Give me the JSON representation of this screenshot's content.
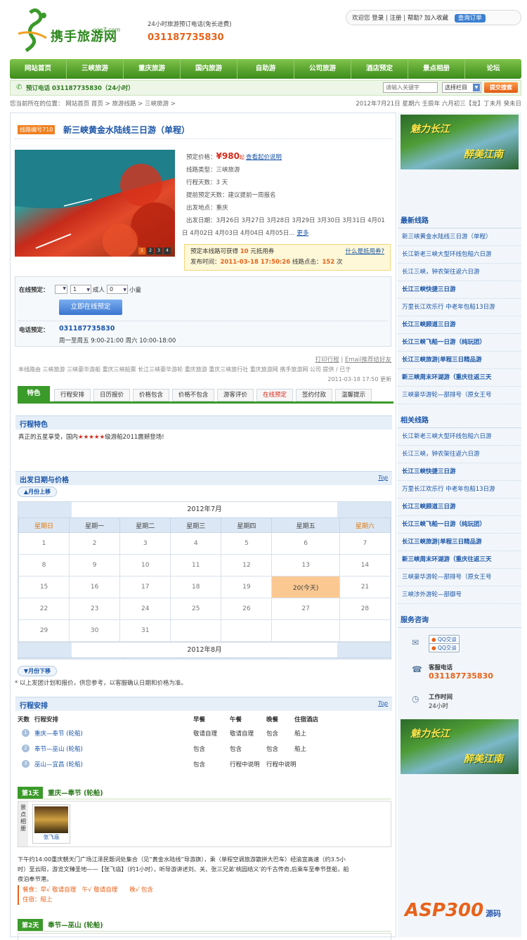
{
  "header": {
    "logo_text": "携手旅游网",
    "logo_domain": "cqe7.com",
    "hotline_label": "24小时旅游预订电话(免长途费)",
    "hotline_number": "031187735830",
    "welcome": "欢迎您",
    "login": "登录",
    "register": "注册",
    "help": "帮助?",
    "bookmark": "加入收藏",
    "order_query": "查询订单"
  },
  "nav": [
    "网站首页",
    "三峡旅游",
    "重庆旅游",
    "国内旅游",
    "自助游",
    "公司旅游",
    "酒店预定",
    "景点相册",
    "论坛"
  ],
  "subbar": {
    "phone": "预订电话 031187735830（24小时）",
    "search_placeholder": "请输入关键字",
    "column_select": "选择栏目",
    "search_button": "提交搜索"
  },
  "breadcrumb": {
    "prefix": "您当前所在的位置：",
    "items": [
      "网站首页 首页",
      "旅游线路",
      "三峡旅游"
    ],
    "date": "2012年7月21日 星期六 壬辰年 六月初三【龙】丁未月 癸未日"
  },
  "route": {
    "code_badge": "线路编号710",
    "title": "新三峡黄金水陆线三日游（单程）",
    "price_label": "预定价格：",
    "price": "¥980",
    "price_suffix": "起",
    "price_link": "查看起价说明",
    "type_label": "线路类型：",
    "type": "三峡旅游",
    "days_label": "行程天数：",
    "days": "3 天",
    "advance_label": "提前预定天数：",
    "advance": "建议提前一周报名",
    "depart_label": "出发地点：",
    "depart": "重庆",
    "dates_label": "出发日期：",
    "dates_line1": "3月26日 3月27日 3月28日 3月29日 3月30日 3月31日 4月01",
    "dates_line2": "日 4月02日 4月03日 4月04日 4月05日...",
    "more": "更多",
    "photo_pages": [
      "1",
      "2",
      "3",
      "4"
    ],
    "coupon_text_a": "预定本线路可获得",
    "coupon_amount": "10",
    "coupon_text_b": "元抵用券",
    "coupon_link": "什么是抵用券?",
    "publish_label": "发布时间：",
    "publish_time": "2011-03-18 17:50:26",
    "clicks_label": "线路点击：",
    "clicks": "152",
    "clicks_unit": "次"
  },
  "booking": {
    "online_label": "在线预定：",
    "adults_value": "1",
    "adults_label": "成人",
    "children_value": "0",
    "children_label": "小童",
    "book_button": "立即在线预定",
    "phone_label": "电话预定：",
    "phone": "031187735830",
    "hours": "周一至周五 9:00-21:00 周六 10:00-18:00"
  },
  "tools": {
    "print": "打印行程",
    "email": "Email推荐给好友"
  },
  "tags_line1": "本线路由 三峡旅游 三峡豪华游船 重庆三峡船票 长江三峡豪华游轮 重庆旅游 重庆三峡旅行社 重庆旅游网 携手旅游网 公司 提供 / 已于",
  "tags_line2": "2011-03-18 17:50 更新",
  "tabs": [
    "特色",
    "行程安排",
    "日历报价",
    "价格包含",
    "价格不包含",
    "游客评价",
    "在线预定",
    "签约付款",
    "温馨提示"
  ],
  "feature": {
    "heading": "行程特色",
    "text_a": "真正的五星享受，国内",
    "stars": "★★★★★",
    "text_b": "级游船2011震撼登场!"
  },
  "calendar": {
    "heading": "出发日期与价格",
    "top": "Top",
    "prev": "月份上移",
    "next": "月份下移",
    "month1": "2012年7月",
    "month2": "2012年8月",
    "weekdays": [
      "星期日",
      "星期一",
      "星期二",
      "星期三",
      "星期四",
      "星期五",
      "星期六"
    ],
    "weeks": [
      [
        "1",
        "2",
        "3",
        "4",
        "5",
        "6",
        "7"
      ],
      [
        "8",
        "9",
        "10",
        "11",
        "12",
        "13",
        "14"
      ],
      [
        "15",
        "16",
        "17",
        "18",
        "19",
        "20(今天)",
        "21"
      ],
      [
        "22",
        "23",
        "24",
        "25",
        "26",
        "27",
        "28"
      ],
      [
        "29",
        "30",
        "31",
        "",
        "",
        "",
        ""
      ]
    ],
    "note": "* 以上发团计划和报价，供您参考，以客服确认日期和价格为准。"
  },
  "schedule": {
    "heading": "行程安排",
    "top": "Top",
    "cols": [
      "天数",
      "行程安排",
      "早餐",
      "午餐",
      "晚餐",
      "住宿酒店"
    ],
    "rows": [
      {
        "n": "1",
        "route": "重庆—奉节 (轮船)",
        "b": "敬请自理",
        "l": "敬请自理",
        "d": "包含",
        "h": "船上"
      },
      {
        "n": "2",
        "route": "奉节—巫山 (轮船)",
        "b": "包含",
        "l": "包含",
        "d": "包含",
        "h": "船上"
      },
      {
        "n": "3",
        "route": "巫山—宜昌 (轮船)",
        "b": "包含",
        "l": "行程中说明",
        "d": "行程中说明",
        "h": ""
      }
    ]
  },
  "day1": {
    "badge": "第1天",
    "title": "重庆—奉节 (轮船)",
    "album_label": "景点相册",
    "photo_caption": "张飞庙",
    "desc1": "下午约14:00重庆朝天门广场江泽民题词处集合（见“黄金水陆线”导游旗），乘（单程空调旅游散拼大巴车）经渝宜高速（约3.5小",
    "desc2": "时）至云阳，游览文臻圣地——【张飞庙】（约1小时），听导游讲述刘、关、张三兄弟‘桃园结义’的千古传奇,后乘车至奉节登船，船",
    "desc3": "夜泊奉节港。",
    "meal": "餐食：早√ 敬请自理　午√ 敬请自理　　晚√ 包含",
    "stay": "住宿：船上"
  },
  "day2": {
    "badge": "第2天",
    "title": "奉节—巫山 (轮船)"
  },
  "sidebar": {
    "banner_text1": "魅力长江",
    "banner_text2": "醉美江南",
    "latest_heading": "最新线路",
    "latest": [
      {
        "t": "新三峡黄金水陆线三日游（单程）",
        "b": false
      },
      {
        "t": "长江新老三峡大型环线包船六日游",
        "b": false
      },
      {
        "t": "长江三峡，钟农架往返六日游",
        "b": false
      },
      {
        "t": "长江三峡快捷三日游",
        "b": true
      },
      {
        "t": "万里长江欢乐行 中老年包船13日游",
        "b": false
      },
      {
        "t": "长江三峡顾道三日游",
        "b": true
      },
      {
        "t": "长江三峡飞船一日游（纯玩团）",
        "b": true
      },
      {
        "t": "长江三峡旅游|单程三日精品游",
        "b": true
      },
      {
        "t": "新三峡周末环湖游（重庆往返三天",
        "b": true
      },
      {
        "t": "三峡豪华游轮—部排号（原女王号",
        "b": false
      }
    ],
    "related_heading": "相关线路",
    "related": [
      {
        "t": "长江新老三峡大型环线包船六日游",
        "b": false
      },
      {
        "t": "长江三峡，钟农架往返六日游",
        "b": false
      },
      {
        "t": "长江三峡快捷三日游",
        "b": true
      },
      {
        "t": "万里长江欢乐行 中老年包船13日游",
        "b": false
      },
      {
        "t": "长江三峡顾道三日游",
        "b": true
      },
      {
        "t": "长江三峡飞船一日游（纯玩团）",
        "b": true
      },
      {
        "t": "长江三峡旅游|单程三日精品游",
        "b": true
      },
      {
        "t": "新三峡周末环湖游（重庆往返三天",
        "b": true
      },
      {
        "t": "三峡豪华游轮—部排号（原女王号",
        "b": false
      },
      {
        "t": "三峡涉外游轮—部御号",
        "b": false
      }
    ],
    "service_heading": "服务咨询",
    "qq1": "QQ交谈",
    "qq2": "QQ交谈",
    "hotline_label": "客服电话",
    "hotline": "031187735830",
    "work_label": "工作时间",
    "work": "24小时",
    "watermark": "ASP300",
    "watermark_cn": "源码"
  },
  "colors": {
    "green": "#3c8c1c",
    "orange": "#e8621a",
    "blue": "#1a55a8",
    "red": "#d62a1a"
  }
}
